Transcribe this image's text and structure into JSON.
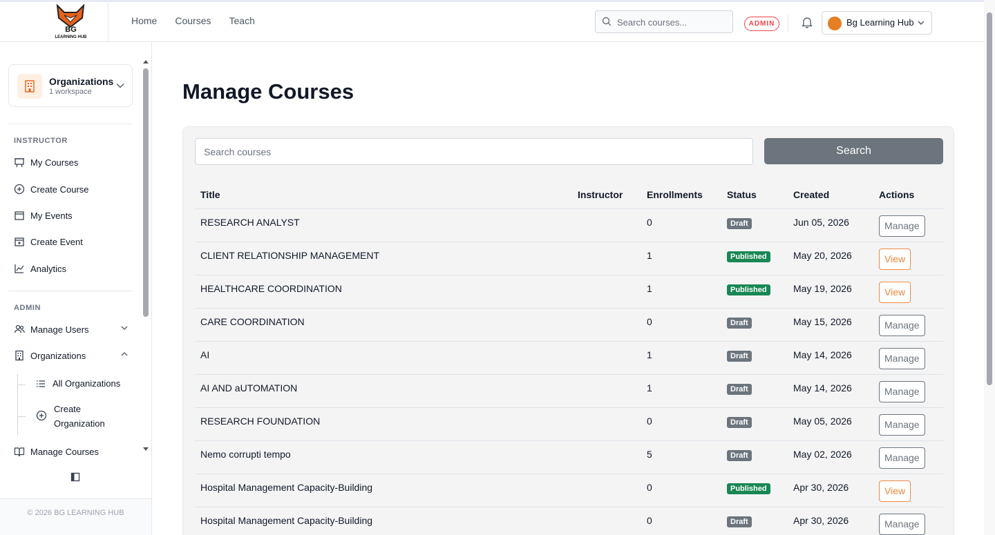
{
  "brand": {
    "name": "BG",
    "sub": "LEARNING HUB"
  },
  "topnav": [
    {
      "label": "Home"
    },
    {
      "label": "Courses"
    },
    {
      "label": "Teach"
    }
  ],
  "top_search": {
    "placeholder": "Search courses..."
  },
  "role_badge": "ADMIN",
  "account": {
    "name": "Bg Learning Hub"
  },
  "sidebar": {
    "org_switcher": {
      "title": "Organizations",
      "subtitle": "1 workspace"
    },
    "instructor_label": "INSTRUCTOR",
    "instructor_items": [
      {
        "label": "My Courses"
      },
      {
        "label": "Create Course"
      },
      {
        "label": "My Events"
      },
      {
        "label": "Create Event"
      },
      {
        "label": "Analytics"
      }
    ],
    "admin_label": "ADMIN",
    "admin_items": [
      {
        "label": "Manage Users"
      },
      {
        "label": "Organizations"
      },
      {
        "label": "Manage Courses"
      }
    ],
    "org_sub_items": [
      {
        "label": "All Organizations"
      },
      {
        "label": "Create Organization"
      }
    ],
    "footer": "© 2026 BG LEARNING HUB"
  },
  "main": {
    "title": "Manage Courses",
    "search": {
      "placeholder": "Search courses",
      "button": "Search"
    },
    "columns": [
      "Title",
      "Instructor",
      "Enrollments",
      "Status",
      "Created",
      "Actions"
    ],
    "rows": [
      {
        "title": "RESEARCH ANALYST",
        "instructor": "",
        "enrollments": "0",
        "status": "Draft",
        "created": "Jun 05, 2026",
        "action": "Manage"
      },
      {
        "title": "CLIENT RELATIONSHIP MANAGEMENT",
        "instructor": "",
        "enrollments": "1",
        "status": "Published",
        "created": "May 20, 2026",
        "action": "View"
      },
      {
        "title": "HEALTHCARE COORDINATION",
        "instructor": "",
        "enrollments": "1",
        "status": "Published",
        "created": "May 19, 2026",
        "action": "View"
      },
      {
        "title": "CARE COORDINATION",
        "instructor": "",
        "enrollments": "0",
        "status": "Draft",
        "created": "May 15, 2026",
        "action": "Manage"
      },
      {
        "title": "AI",
        "instructor": "",
        "enrollments": "1",
        "status": "Draft",
        "created": "May 14, 2026",
        "action": "Manage"
      },
      {
        "title": "AI AND aUTOMATION",
        "instructor": "",
        "enrollments": "1",
        "status": "Draft",
        "created": "May 14, 2026",
        "action": "Manage"
      },
      {
        "title": "RESEARCH FOUNDATION",
        "instructor": "",
        "enrollments": "0",
        "status": "Draft",
        "created": "May 05, 2026",
        "action": "Manage"
      },
      {
        "title": "Nemo corrupti tempo",
        "instructor": "",
        "enrollments": "5",
        "status": "Draft",
        "created": "May 02, 2026",
        "action": "Manage"
      },
      {
        "title": "Hospital Management Capacity-Building",
        "instructor": "",
        "enrollments": "0",
        "status": "Published",
        "created": "Apr 30, 2026",
        "action": "View"
      },
      {
        "title": "Hospital Management Capacity-Building",
        "instructor": "",
        "enrollments": "0",
        "status": "Draft",
        "created": "Apr 30, 2026",
        "action": "Manage"
      }
    ]
  },
  "colors": {
    "accent": "#f0883e",
    "draft": "#6c757d",
    "published": "#198754",
    "admin": "#ef4444"
  }
}
